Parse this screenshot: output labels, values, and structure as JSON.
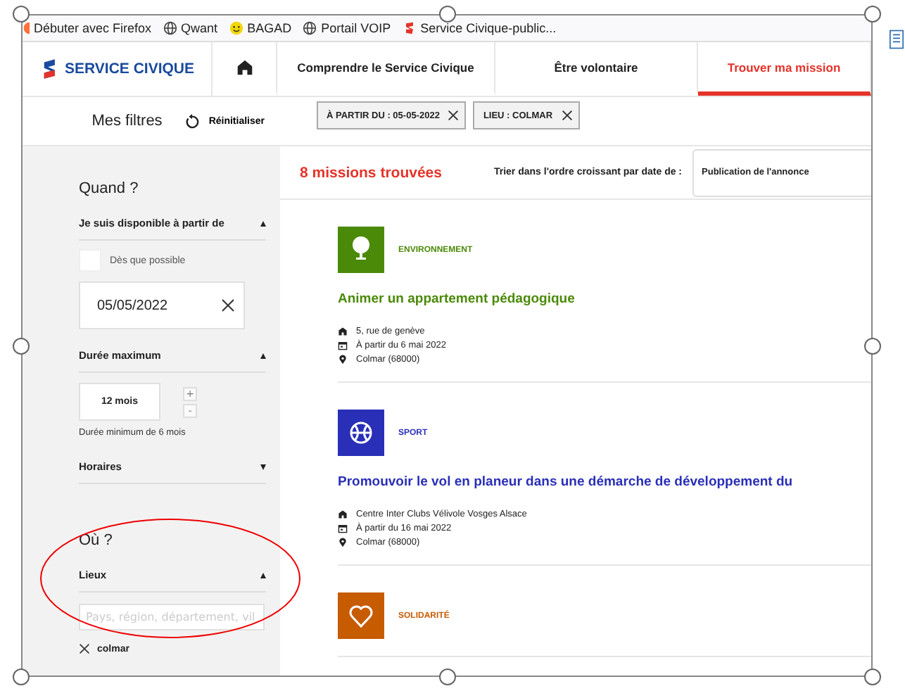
{
  "bookmarks": [
    {
      "label": "Débuter avec Firefox",
      "kind": "firefox"
    },
    {
      "label": "Qwant",
      "kind": "globe"
    },
    {
      "label": "BAGAD",
      "kind": "smiley"
    },
    {
      "label": "Portail VOIP",
      "kind": "globe"
    },
    {
      "label": "Service Civique-public...",
      "kind": "logo"
    }
  ],
  "nav": {
    "logo": "SERVICE CIVIQUE",
    "items": [
      {
        "kind": "home",
        "selected": false
      },
      {
        "kind": "text",
        "label": "Comprendre le Service Civique",
        "selected": false
      },
      {
        "kind": "text",
        "label": "Être volontaire",
        "selected": false
      },
      {
        "kind": "text",
        "label": "Trouver ma mission",
        "selected": true
      }
    ]
  },
  "filters": {
    "title": "Mes filtres",
    "reset": "Réinitialiser",
    "chips": [
      {
        "label": "À PARTIR DU : 05-05-2022"
      },
      {
        "label": "LIEU : COLMAR"
      }
    ]
  },
  "sidebar": {
    "when_heading": "Quand ?",
    "availability": {
      "label": "Je suis disponible à partir de",
      "expanded": true,
      "asap": {
        "label": "Dès que possible",
        "checked": false
      },
      "date": "05/05/2022"
    },
    "duration": {
      "label": "Durée maximum",
      "expanded": true,
      "value": "12 mois",
      "plus": "+",
      "minus": "-",
      "note": "Durée minimum de 6 mois"
    },
    "schedule": {
      "label": "Horaires",
      "expanded": false
    },
    "where_heading": "Où ?",
    "places": {
      "label": "Lieux",
      "expanded": true,
      "placeholder": "Pays, région, département, vil",
      "selected_places": [
        {
          "label": "colmar"
        }
      ]
    }
  },
  "results": {
    "count": "8 missions trouvées",
    "sort_label": "Trier dans l'ordre croissant par date de :",
    "sort_value": "Publication de l'annonce",
    "missions": [
      {
        "category": "ENVIRONNEMENT",
        "kind": "tree",
        "color": "#4b8a08",
        "title": "Animer un appartement pédagogique",
        "organisation": "5, rue de genève",
        "start": "À partir du 6 mai 2022",
        "place": "Colmar (68000)"
      },
      {
        "category": "SPORT",
        "kind": "ball",
        "color": "#2a2fb8",
        "title": "Promouvoir le vol en planeur dans une démarche de développement du",
        "organisation": "Centre Inter Clubs Vélivole Vosges Alsace",
        "start": "À partir du 16 mai 2022",
        "place": "Colmar (68000)"
      },
      {
        "category": "SOLIDARITÉ",
        "kind": "heart",
        "color": "#c75b00"
      }
    ]
  }
}
